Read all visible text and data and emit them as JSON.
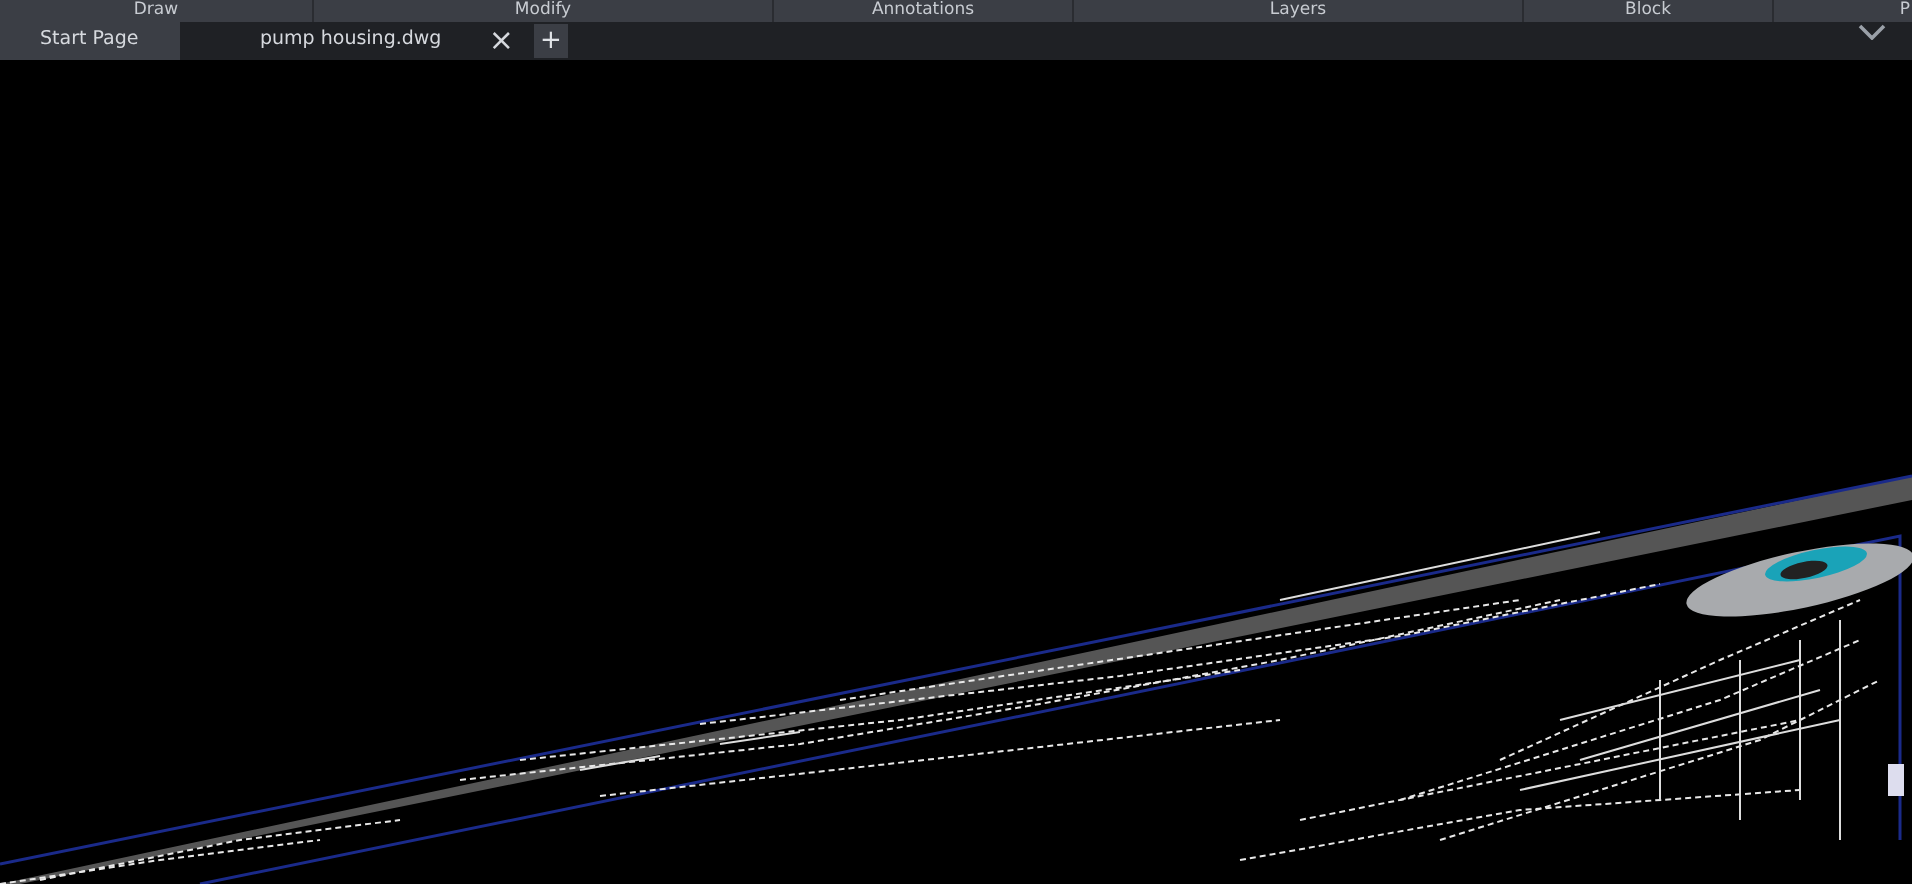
{
  "ribbon_panels": [
    {
      "label": "Draw"
    },
    {
      "label": "Modify"
    },
    {
      "label": "Annotations"
    },
    {
      "label": "Layers"
    },
    {
      "label": "Block"
    },
    {
      "label": "P"
    }
  ],
  "file_tabs": [
    {
      "label": "Start Page",
      "selected": false
    },
    {
      "label": "pump housing.dwg",
      "selected": true,
      "close_glyph": "×"
    }
  ],
  "new_tab_glyph": "+"
}
